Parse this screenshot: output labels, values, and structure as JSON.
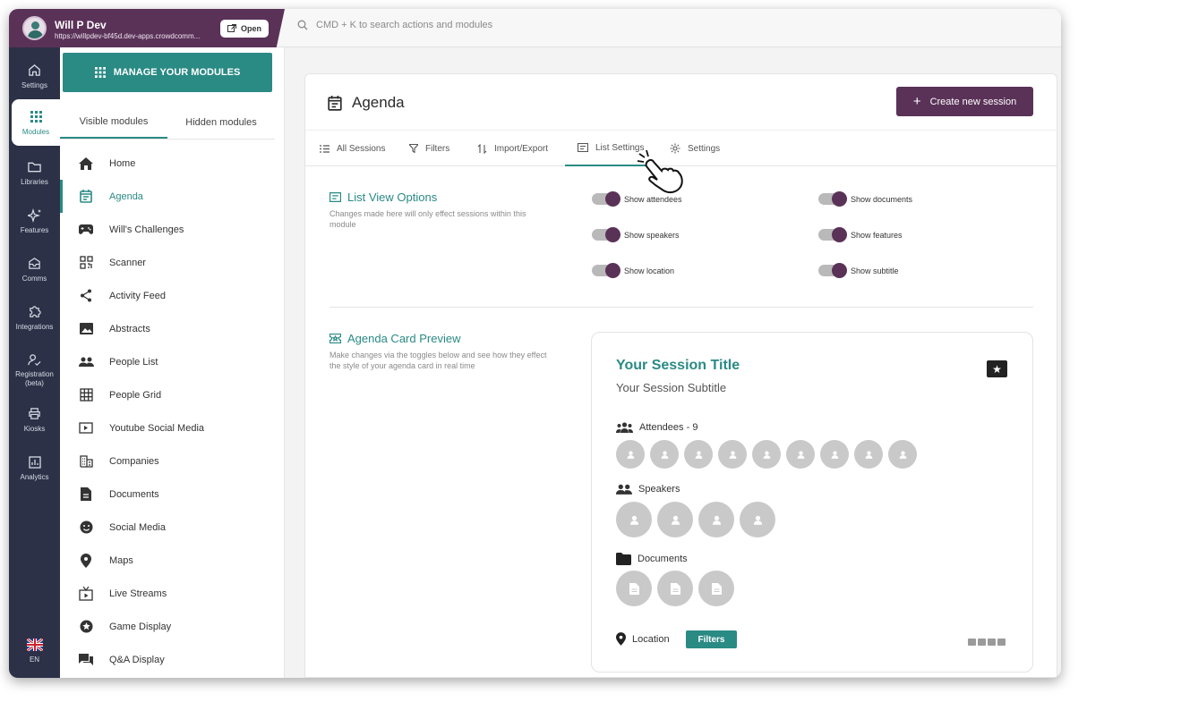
{
  "account": {
    "name": "Will P Dev",
    "url": "https://willpdev-bf45d.dev-apps.crowdcomm...",
    "open_label": "Open"
  },
  "search": {
    "placeholder": "CMD + K to search actions and modules",
    "icon": "search-icon"
  },
  "rail": {
    "items": [
      {
        "label": "Settings",
        "icon": "home-icon"
      },
      {
        "label": "Modules",
        "icon": "grid-icon",
        "active": true
      },
      {
        "label": "Libraries",
        "icon": "folder-icon"
      },
      {
        "label": "Features",
        "icon": "sparkle-icon"
      },
      {
        "label": "Comms",
        "icon": "inbox-icon"
      },
      {
        "label": "Integrations",
        "icon": "puzzle-icon"
      },
      {
        "label": "Registration (beta)",
        "icon": "registration-icon"
      },
      {
        "label": "Kiosks",
        "icon": "printer-icon"
      },
      {
        "label": "Analytics",
        "icon": "analytics-icon"
      }
    ],
    "language": "EN"
  },
  "modules_panel": {
    "manage_label": "MANAGE YOUR MODULES",
    "tabs": [
      "Visible modules",
      "Hidden modules"
    ],
    "items": [
      {
        "label": "Home",
        "icon": "home-icon"
      },
      {
        "label": "Agenda",
        "icon": "calendar-icon",
        "active": true
      },
      {
        "label": "Will's Challenges",
        "icon": "gamepad-icon"
      },
      {
        "label": "Scanner",
        "icon": "qr-icon"
      },
      {
        "label": "Activity Feed",
        "icon": "share-icon"
      },
      {
        "label": "Abstracts",
        "icon": "image-icon"
      },
      {
        "label": "People List",
        "icon": "people-icon"
      },
      {
        "label": "People Grid",
        "icon": "grid-table-icon"
      },
      {
        "label": "Youtube Social Media",
        "icon": "video-icon"
      },
      {
        "label": "Companies",
        "icon": "building-icon"
      },
      {
        "label": "Documents",
        "icon": "document-icon"
      },
      {
        "label": "Social Media",
        "icon": "smiley-icon"
      },
      {
        "label": "Maps",
        "icon": "pin-icon"
      },
      {
        "label": "Live Streams",
        "icon": "tv-icon"
      },
      {
        "label": "Game Display",
        "icon": "star-circle-icon"
      },
      {
        "label": "Q&A Display",
        "icon": "chat-icon"
      }
    ]
  },
  "page": {
    "title": "Agenda",
    "create_label": "Create new session",
    "tabs": [
      {
        "label": "All Sessions",
        "icon": "list-icon"
      },
      {
        "label": "Filters",
        "icon": "filter-icon"
      },
      {
        "label": "Import/Export",
        "icon": "import-export-icon"
      },
      {
        "label": "List Settings",
        "icon": "list-settings-icon",
        "active": true
      },
      {
        "label": "Settings",
        "icon": "gear-icon"
      }
    ]
  },
  "list_view": {
    "title": "List View Options",
    "description": "Changes made here will only effect sessions within this module",
    "toggles": [
      {
        "label": "Show attendees",
        "on": true
      },
      {
        "label": "Show documents",
        "on": true
      },
      {
        "label": "Show speakers",
        "on": true
      },
      {
        "label": "Show features",
        "on": true
      },
      {
        "label": "Show location",
        "on": true
      },
      {
        "label": "Show subtitle",
        "on": true
      }
    ]
  },
  "preview": {
    "title": "Agenda Card Preview",
    "description": "Make changes via the toggles below and see how they effect the style of your agenda card in real time",
    "card": {
      "session_title": "Your Session Title",
      "session_subtitle": "Your Session Subtitle",
      "attendees_label": "Attendees - 9",
      "attendee_count": 9,
      "speakers_label": "Speakers",
      "speaker_count": 4,
      "documents_label": "Documents",
      "document_count": 3,
      "location_label": "Location",
      "filters_chip": "Filters"
    }
  },
  "colors": {
    "accent": "#2a8a84",
    "brand": "#5a3258",
    "rail": "#2c3147"
  }
}
